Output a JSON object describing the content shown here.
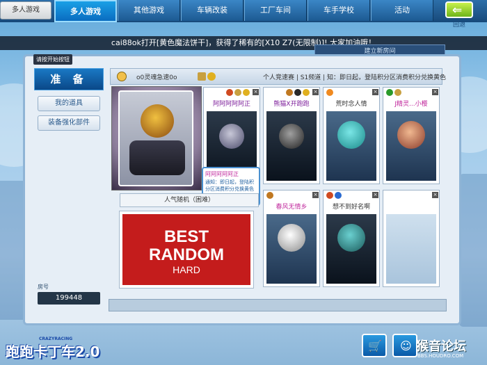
{
  "nav": {
    "home": "多人游戏",
    "tabs": [
      "多人游戏",
      "其他游戏",
      "车辆改装",
      "工厂车间",
      "车手学校",
      "活动"
    ],
    "active_index": 0,
    "back_label": "回退"
  },
  "notice": {
    "text": "cai88ok打开[黄色魔法饼干]，获得了稀有的[X10 Z7(无限制)]! 大家加油哦！",
    "sub_text": "建立新房间"
  },
  "hint": "请按开始按钮",
  "left": {
    "ready": "准 备",
    "my_items": "我的道具",
    "equip_upgrade": "装备强化部件",
    "room_label": "房号",
    "room_number": "199448"
  },
  "header": {
    "player_name": "o0灵魂急速0o",
    "mode": "个人竞速赛",
    "channel": "S1频道",
    "news": "知：即日起，登陆积分区消费积分兑换黄色"
  },
  "slots": [
    {
      "name": "阿阿阿阿阿正",
      "style": "dark"
    },
    {
      "name": "熊猫X开跑跑",
      "style": "dark"
    },
    {
      "name": "荒时念人情",
      "style": "light"
    },
    {
      "name": "J精灵...小樱",
      "style": "light"
    },
    {
      "name": "春风无情乡",
      "style": "light"
    },
    {
      "name": "想不到好名啊",
      "style": "dark"
    },
    {
      "name": "",
      "style": "empty"
    }
  ],
  "tooltip": {
    "title": "阿阿阿阿阿正",
    "body": "通知：即日起，登陆积分区消费积分兑换黄色星星糖"
  },
  "map": {
    "label": "人气随机（困难）",
    "banner_title_1": "BEST",
    "banner_title_2": "RANDOM",
    "difficulty": "HARD"
  },
  "logo": {
    "main": "跑跑卡丁车2.0",
    "sub": "CRAZYRACING"
  },
  "watermark": {
    "text": "猴音论坛",
    "url": "BBS.HOUDRO.COM"
  },
  "colors": {
    "nav_active": "#0a6cc0",
    "ready": "#0a4888",
    "banner": "#c41c1c",
    "name_color": "#7c1c9a"
  }
}
